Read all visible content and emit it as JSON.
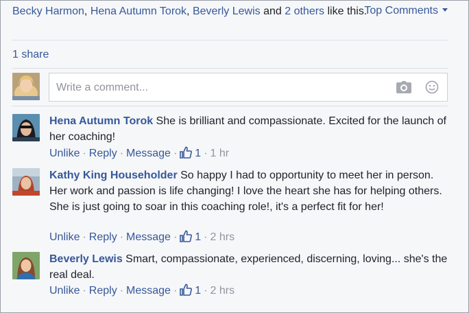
{
  "likes": {
    "names": [
      "Becky Harmon",
      "Hena Autumn Torok",
      "Beverly Lewis"
    ],
    "sep1": ", ",
    "sep2": ", ",
    "and_text": " and ",
    "others_link": "2 others",
    "suffix": " like this."
  },
  "sort": {
    "label": "Top Comments"
  },
  "shares": {
    "label": "1 share"
  },
  "composer": {
    "placeholder": "Write a comment..."
  },
  "comments": [
    {
      "author": "Hena Autumn Torok",
      "text": " She is brilliant and compassionate. Excited for the launch of her coaching!",
      "actions": {
        "unlike": "Unlike",
        "reply": "Reply",
        "message": "Message"
      },
      "likes": "1",
      "time": "1 hr"
    },
    {
      "author": "Kathy King Householder",
      "text": " So happy I had to opportunity to meet her in person. Her work and passion is life changing! I love the heart she has for helping others. She is just going to soar in this coaching role!, it's a perfect fit for her!",
      "actions": {
        "unlike": "Unlike",
        "reply": "Reply",
        "message": "Message"
      },
      "likes": "1",
      "time": "2 hrs"
    },
    {
      "author": "Beverly Lewis",
      "text": " Smart, compassionate, experienced, discerning, loving... she's the real deal.",
      "actions": {
        "unlike": "Unlike",
        "reply": "Reply",
        "message": "Message"
      },
      "likes": "1",
      "time": "2 hrs"
    }
  ],
  "colors": {
    "link": "#365899",
    "text": "#1d2129",
    "meta": "#90949c",
    "background": "#f6f7f9"
  },
  "icons": {
    "camera": "camera-icon",
    "smiley": "smiley-icon",
    "like": "thumbs-up-icon",
    "caret": "chevron-down-icon"
  }
}
